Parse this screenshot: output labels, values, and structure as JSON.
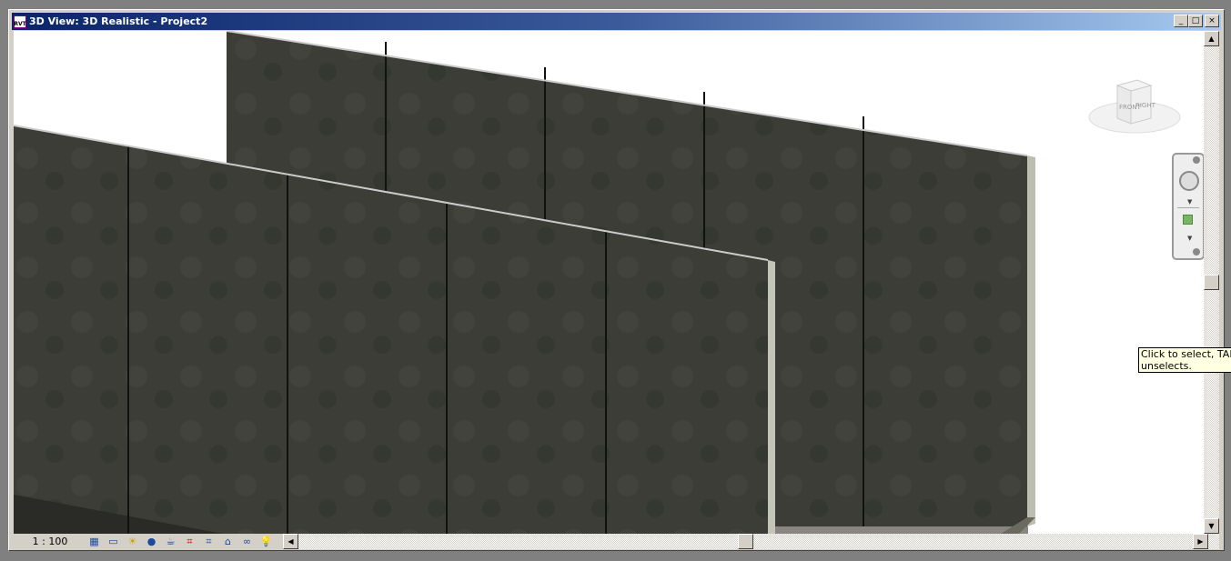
{
  "window": {
    "title": "3D View: 3D Realistic - Project2",
    "app_icon": "RVT",
    "buttons": [
      "_",
      "□",
      "×"
    ]
  },
  "viewcube": {
    "faces": [
      "FRONT",
      "RIGHT"
    ]
  },
  "status": {
    "scale": "1 : 100",
    "icons": [
      "detail-level-icon",
      "visual-style-icon",
      "sun-path-off-icon",
      "shadows-icon",
      "rendering-icon",
      "crop-view-icon",
      "show-crop-icon",
      "lock-3d-view-icon",
      "temporary-hide-icon",
      "reveal-hidden-icon"
    ]
  },
  "tooltip": {
    "line1": "Click to select, TAB for alternates, CTRL adds, SHIFT",
    "line2": "unselects."
  },
  "colors": {
    "title_start": "#0a246a",
    "title_end": "#a6caf0",
    "wall": "#3b3d36"
  }
}
